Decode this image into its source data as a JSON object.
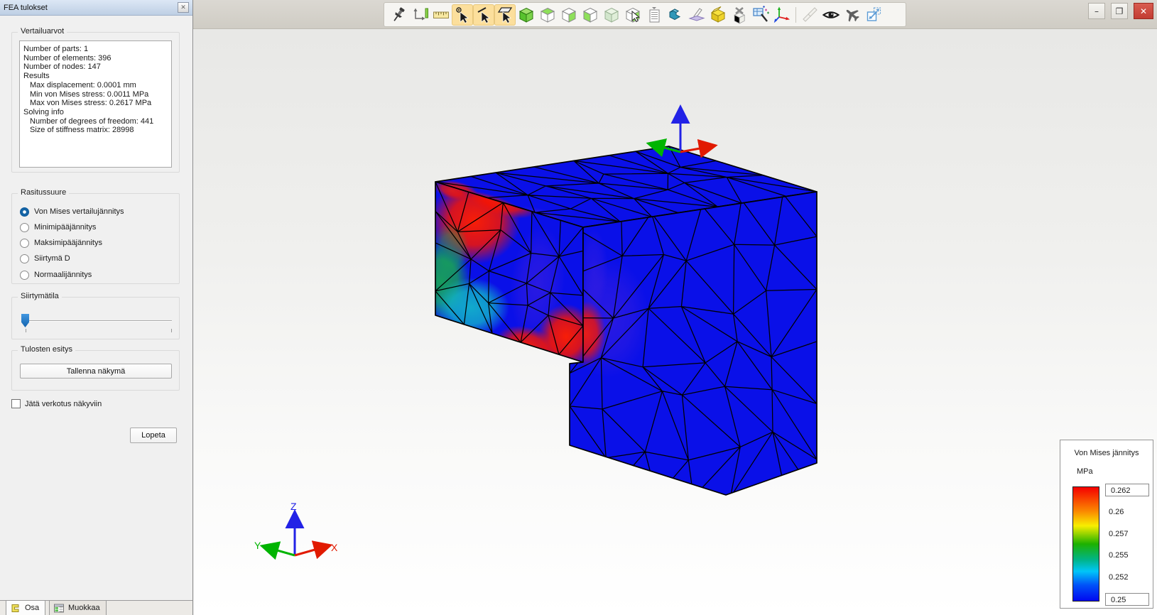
{
  "panel": {
    "title": "FEA tulokset",
    "groups": {
      "vertailuarvot": {
        "label": "Vertailuarvot",
        "lines": [
          {
            "text": "Number of parts: 1",
            "indent": 0
          },
          {
            "text": "Number of elements: 396",
            "indent": 0
          },
          {
            "text": "Number of nodes: 147",
            "indent": 0
          },
          {
            "text": "Results",
            "indent": 0
          },
          {
            "text": "Max displacement: 0.0001 mm",
            "indent": 1
          },
          {
            "text": "Min von Mises stress: 0.0011 MPa",
            "indent": 1
          },
          {
            "text": "Max von Mises stress: 0.2617 MPa",
            "indent": 1
          },
          {
            "text": "Solving info",
            "indent": 0
          },
          {
            "text": "Number of degrees of freedom: 441",
            "indent": 1
          },
          {
            "text": "Size of stiffness matrix: 28998",
            "indent": 1
          }
        ]
      },
      "rasitussuure": {
        "label": "Rasitussuure",
        "options": [
          {
            "label": "Von Mises vertailujännitys",
            "selected": true
          },
          {
            "label": "Minimipääjännitys",
            "selected": false
          },
          {
            "label": "Maksimipääjännitys",
            "selected": false
          },
          {
            "label": "Siirtymä D",
            "selected": false
          },
          {
            "label": "Normaalijännitys",
            "selected": false
          }
        ]
      },
      "siirtymatila": {
        "label": "Siirtymätila",
        "slider_value": 0
      },
      "tulosten_esitys": {
        "label": "Tulosten esitys",
        "save_button_label": "Tallenna näkymä"
      }
    },
    "mesh_checkbox_label": "Jätä verkotus näkyviin",
    "mesh_checkbox_checked": false,
    "quit_button_label": "Lopeta"
  },
  "toolbar": {
    "icons": [
      {
        "name": "pin",
        "highlighted": false
      },
      {
        "name": "fit-view",
        "highlighted": false
      },
      {
        "name": "measure",
        "highlighted": false
      },
      {
        "name": "select-vertex",
        "highlighted": true
      },
      {
        "name": "select-edge",
        "highlighted": true
      },
      {
        "name": "select-face",
        "highlighted": true
      },
      {
        "name": "view-shaded",
        "highlighted": false
      },
      {
        "name": "view-top",
        "highlighted": false
      },
      {
        "name": "view-right",
        "highlighted": false
      },
      {
        "name": "view-front",
        "highlighted": false
      },
      {
        "name": "view-iso",
        "highlighted": false
      },
      {
        "name": "select-body",
        "highlighted": false
      },
      {
        "name": "feature-list",
        "highlighted": false
      },
      {
        "name": "extrude",
        "highlighted": false
      },
      {
        "name": "bend",
        "highlighted": false
      },
      {
        "name": "open-box",
        "highlighted": false
      },
      {
        "name": "delete-face",
        "highlighted": false
      },
      {
        "name": "box-select",
        "highlighted": false
      },
      {
        "name": "coordinate-axes",
        "highlighted": false
      },
      {
        "name": "separator",
        "highlighted": false
      },
      {
        "name": "sketch",
        "highlighted": false
      },
      {
        "name": "visibility",
        "highlighted": false
      },
      {
        "name": "fly-mode",
        "highlighted": false
      },
      {
        "name": "expand-view",
        "highlighted": false
      }
    ]
  },
  "window_controls": {
    "minimize": "–",
    "restore": "❐",
    "close": "✕"
  },
  "tabs": [
    {
      "label": "Osa",
      "icon": "part-icon",
      "active": true
    },
    {
      "label": "Muokkaa",
      "icon": "table-icon",
      "active": false
    }
  ],
  "viewport": {
    "axes": {
      "labels": {
        "x": "X",
        "y": "Y",
        "z": "Z"
      },
      "colors": {
        "x": "#e11a00",
        "y": "#00b400",
        "z": "#2222e6"
      }
    },
    "model": {
      "base_color": "#0a10e8",
      "mesh_color": "#000000",
      "hotspot_colors": {
        "max_stress": "#f81400",
        "mid_stress": "#18ab4e",
        "low_mid_stress": "#12bac9",
        "blend": "#5f2bd8"
      }
    }
  },
  "legend": {
    "title": "Von Mises jännitys",
    "unit": "MPa",
    "entries": [
      {
        "value": "0.262",
        "boxed": true
      },
      {
        "value": "0.26",
        "boxed": false
      },
      {
        "value": "0.257",
        "boxed": false
      },
      {
        "value": "0.255",
        "boxed": false
      },
      {
        "value": "0.252",
        "boxed": false
      },
      {
        "value": "0.25",
        "boxed": true
      }
    ],
    "gradient": [
      "#f50000",
      "#fb8e00",
      "#f8ee00",
      "#1db100",
      "#00b489",
      "#00c6f8",
      "#0008f0"
    ]
  }
}
